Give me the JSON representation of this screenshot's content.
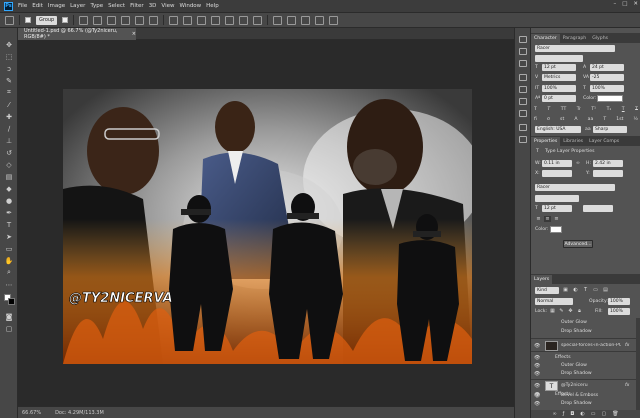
{
  "menu": {
    "logo": "Ps",
    "items": [
      "File",
      "Edit",
      "Image",
      "Layer",
      "Type",
      "Select",
      "Filter",
      "3D",
      "View",
      "Window",
      "Help"
    ],
    "window_controls": [
      "–",
      "□",
      "✕"
    ]
  },
  "options_bar": {
    "autoselect_value": "Group"
  },
  "document": {
    "tab_title": "Untitled-1.psd @ 66.7% (@Ty2niceru, RGB/8#) *",
    "close": "×",
    "watermark": "@TY2NICERVA"
  },
  "status": {
    "zoom": "66.67%",
    "doc_size": "Doc: 4.29M/113.3M"
  },
  "character_panel": {
    "tabs": [
      "Character",
      "Paragraph",
      "Glyphs"
    ],
    "font_family": "Racer",
    "font_size": "12 pt",
    "leading": "24 pt",
    "kerning": "Metrics",
    "tracking": "-25",
    "vscale": "100%",
    "hscale": "100%",
    "baseline": "0 pt",
    "color_label": "Color:",
    "style_buttons": [
      "T",
      "T",
      "TT",
      "Tr",
      "T¹",
      "T₁",
      "T",
      "T"
    ],
    "opentype_buttons": [
      "fi",
      "σ",
      "st",
      "A",
      "aa",
      "T",
      "1st",
      "½"
    ],
    "language": "English: USA",
    "antialias": "Sharp"
  },
  "properties_panel": {
    "tabs": [
      "Properties",
      "Libraries",
      "Layer Comps"
    ],
    "title": "Type Layer Properties",
    "w": "0.11 in",
    "h": "2.42 in",
    "x": "",
    "y": "",
    "font": "Racer",
    "size": "12 pt",
    "color_label": "Color:",
    "advanced_button": "Advanced..."
  },
  "layers_panel": {
    "tab": "Layers",
    "filter_kind": "Kind",
    "blend_mode": "Normal",
    "opacity_label": "Opacity:",
    "opacity": "100%",
    "lock_label": "Lock:",
    "fill_label": "Fill:",
    "fill": "100%",
    "rows": [
      {
        "name": "Outer Glow",
        "kind": "effect"
      },
      {
        "name": "Drop Shadow",
        "kind": "effect"
      },
      {
        "name": "special-forces-in-action-PC...",
        "kind": "layer",
        "fx": "fx"
      },
      {
        "name": "Effects",
        "kind": "effects-header"
      },
      {
        "name": "Outer Glow",
        "kind": "effect"
      },
      {
        "name": "Drop Shadow",
        "kind": "effect"
      },
      {
        "name": "@Ty2niceru",
        "kind": "layer",
        "fx": "fx"
      },
      {
        "name": "Effects",
        "kind": "effects-header"
      },
      {
        "name": "Bevel & Emboss",
        "kind": "effect"
      },
      {
        "name": "Drop Shadow",
        "kind": "effect"
      }
    ]
  },
  "colors": {
    "app_bg": "#535353",
    "canvas_bg": "#2a2a2a",
    "panel_dark": "#474747",
    "accent_blue": "#31a8ff"
  }
}
